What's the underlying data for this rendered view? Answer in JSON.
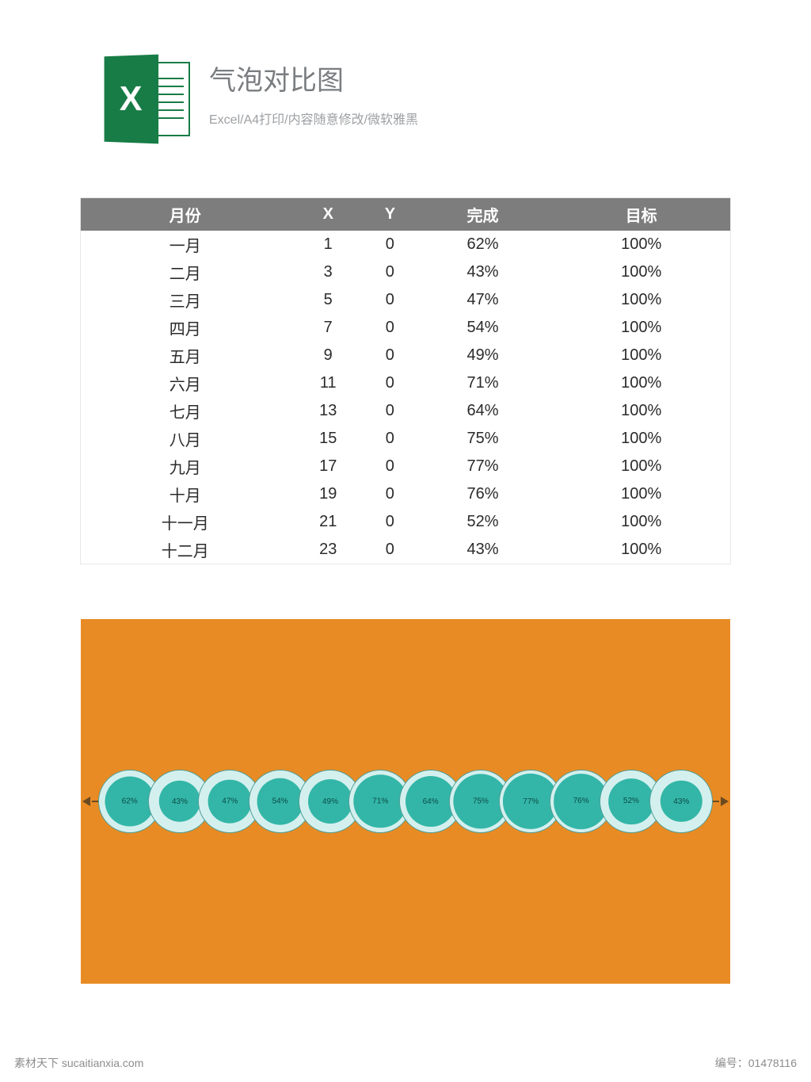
{
  "header": {
    "icon_letter": "X",
    "title": "气泡对比图",
    "subtitle": "Excel/A4打印/内容随意修改/微软雅黑"
  },
  "table": {
    "headers": [
      "月份",
      "X",
      "Y",
      "完成",
      "目标"
    ],
    "rows": [
      {
        "month": "一月",
        "x": "1",
        "y": "0",
        "complete": "62%",
        "target": "100%"
      },
      {
        "month": "二月",
        "x": "3",
        "y": "0",
        "complete": "43%",
        "target": "100%"
      },
      {
        "month": "三月",
        "x": "5",
        "y": "0",
        "complete": "47%",
        "target": "100%"
      },
      {
        "month": "四月",
        "x": "7",
        "y": "0",
        "complete": "54%",
        "target": "100%"
      },
      {
        "month": "五月",
        "x": "9",
        "y": "0",
        "complete": "49%",
        "target": "100%"
      },
      {
        "month": "六月",
        "x": "11",
        "y": "0",
        "complete": "71%",
        "target": "100%"
      },
      {
        "month": "七月",
        "x": "13",
        "y": "0",
        "complete": "64%",
        "target": "100%"
      },
      {
        "month": "八月",
        "x": "15",
        "y": "0",
        "complete": "75%",
        "target": "100%"
      },
      {
        "month": "九月",
        "x": "17",
        "y": "0",
        "complete": "77%",
        "target": "100%"
      },
      {
        "month": "十月",
        "x": "19",
        "y": "0",
        "complete": "76%",
        "target": "100%"
      },
      {
        "month": "十一月",
        "x": "21",
        "y": "0",
        "complete": "52%",
        "target": "100%"
      },
      {
        "month": "十二月",
        "x": "23",
        "y": "0",
        "complete": "43%",
        "target": "100%"
      }
    ]
  },
  "chart_data": {
    "type": "bubble",
    "title": "气泡对比图",
    "xlabel": "",
    "ylabel": "",
    "categories": [
      "一月",
      "二月",
      "三月",
      "四月",
      "五月",
      "六月",
      "七月",
      "八月",
      "九月",
      "十月",
      "十一月",
      "十二月"
    ],
    "x": [
      1,
      3,
      5,
      7,
      9,
      11,
      13,
      15,
      17,
      19,
      21,
      23
    ],
    "y": [
      0,
      0,
      0,
      0,
      0,
      0,
      0,
      0,
      0,
      0,
      0,
      0
    ],
    "series": [
      {
        "name": "目标",
        "values": [
          100,
          100,
          100,
          100,
          100,
          100,
          100,
          100,
          100,
          100,
          100,
          100
        ]
      },
      {
        "name": "完成",
        "values": [
          62,
          43,
          47,
          54,
          49,
          71,
          64,
          75,
          77,
          76,
          52,
          43
        ]
      }
    ],
    "data_labels": [
      "62%",
      "43%",
      "47%",
      "54%",
      "49%",
      "71%",
      "64%",
      "75%",
      "77%",
      "76%",
      "52%",
      "43%"
    ],
    "colors": {
      "target": "#d4f0ee",
      "complete": "#33b6a8",
      "background": "#e88b24"
    }
  },
  "footer": {
    "left": "素材天下 sucaitianxia.com",
    "right": "编号：01478116"
  }
}
